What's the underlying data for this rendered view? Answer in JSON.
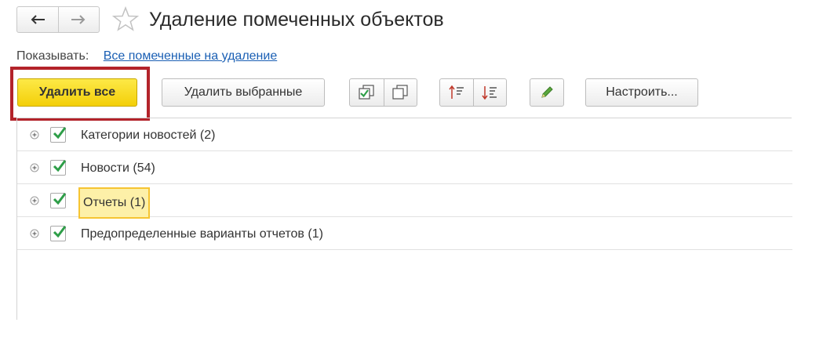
{
  "window": {
    "title": "Удаление помеченных объектов"
  },
  "filter": {
    "label": "Показывать:",
    "value": "Все помеченные на удаление"
  },
  "toolbar": {
    "delete_all_label": "Удалить все",
    "delete_selected_label": "Удалить выбранные",
    "settings_label": "Настроить..."
  },
  "tree": {
    "rows": [
      {
        "label": "Категории новостей (2)",
        "checked": true,
        "current": false
      },
      {
        "label": "Новости (54)",
        "checked": true,
        "current": false
      },
      {
        "label": "Отчеты (1)",
        "checked": true,
        "current": true
      },
      {
        "label": "Предопределенные варианты отчетов (1)",
        "checked": true,
        "current": false
      }
    ]
  },
  "colors": {
    "primary_button": "#f3cf08",
    "highlight_frame": "#b3232a",
    "checkmark": "#2e9e48",
    "link": "#1a5fb4",
    "current_row": "#fdf0a8"
  },
  "icons": {
    "back": "arrow-left-icon",
    "forward": "arrow-right-icon",
    "favorite": "star-icon",
    "check_all": "check-all-icon",
    "uncheck_all": "uncheck-all-icon",
    "sort_asc": "sort-ascending-icon",
    "sort_desc": "sort-descending-icon",
    "edit": "pencil-icon",
    "expand": "expand-plus-icon"
  }
}
